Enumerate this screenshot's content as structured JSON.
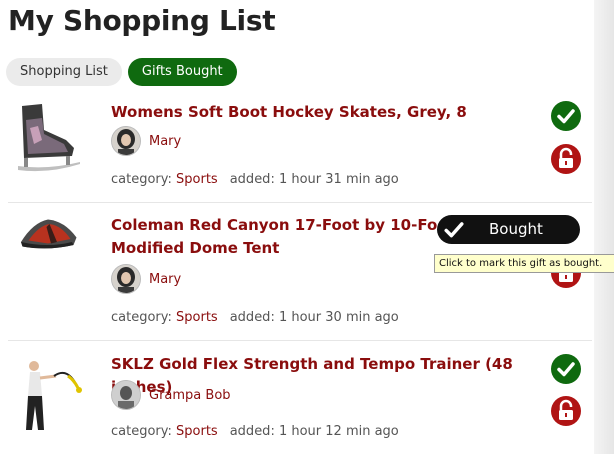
{
  "page": {
    "title": "My Shopping List"
  },
  "tabs": [
    {
      "label": "Shopping List",
      "active": false
    },
    {
      "label": "Gifts Bought",
      "active": true
    }
  ],
  "items": [
    {
      "title_line1": "Womens Soft Boot Hockey Skates, Grey, 8",
      "title_line2": "",
      "person": "Mary",
      "category_label": "category:",
      "category": "Sports",
      "added": "added: 1 hour 31 min ago",
      "image_icon": "hockey-skate"
    },
    {
      "title_line1": "Coleman Red Canyon 17-Foot by 10-Foot 8",
      "title_line2": "Modified Dome Tent",
      "person": "Mary",
      "category_label": "category:",
      "category": "Sports",
      "added": "added: 1 hour 30 min ago",
      "image_icon": "tent"
    },
    {
      "title_line1": "SKLZ Gold Flex Strength and Tempo Trainer (48 inches)",
      "title_line2": "",
      "person": "Grampa Bob",
      "category_label": "category:",
      "category": "Sports",
      "added": "added: 1 hour 12 min ago",
      "image_icon": "golfer"
    }
  ],
  "overlay": {
    "bought_label": "Bought",
    "tooltip": "Click to mark this gift as bought."
  },
  "colors": {
    "accent_green": "#0f6a0f",
    "accent_red": "#b01414",
    "link_red": "#8a0d0d"
  }
}
